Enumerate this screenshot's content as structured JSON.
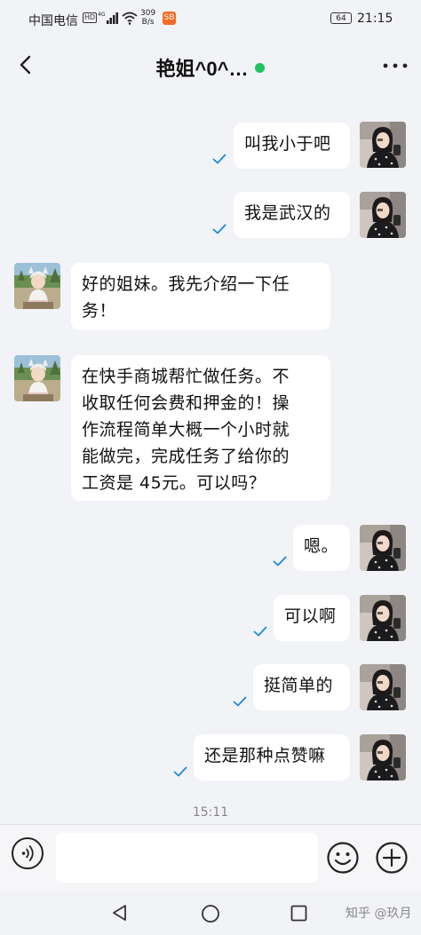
{
  "status_bar": {
    "carrier": "中国电信",
    "hd": "HD",
    "network": "4G",
    "speed_value": "309",
    "speed_unit": "B/s",
    "app_badge": "SB",
    "battery": "64",
    "time": "21:15"
  },
  "header": {
    "title": "艳姐^0^…",
    "online_color": "#21c35c"
  },
  "messages": [
    {
      "side": "right",
      "text": "叫我小于吧",
      "read": true
    },
    {
      "side": "right",
      "text": "我是武汉的",
      "read": true
    },
    {
      "side": "left",
      "lines": [
        "好的姐妹。我先介绍一下任",
        "务！"
      ]
    },
    {
      "side": "left",
      "lines": [
        "在快手商城帮忙做任务。不",
        "收取任何会费和押金的！操",
        "作流程简单大概一个小时就",
        "能做完，完成任务了给你的",
        "工资是 45元。可以吗？"
      ]
    },
    {
      "side": "right",
      "text": "嗯。",
      "read": true
    },
    {
      "side": "right",
      "text": "可以啊",
      "read": true
    },
    {
      "side": "right",
      "text": "挺简单的",
      "read": true
    },
    {
      "side": "right",
      "text": "还是那种点赞嘛",
      "read": true
    }
  ],
  "timestamp": "15:11",
  "input": {
    "placeholder": ""
  },
  "watermark": "知乎 @玖月",
  "colors": {
    "accent": "#1a8ad8",
    "bubble": "#ffffff",
    "background": "#f2f3f7"
  }
}
